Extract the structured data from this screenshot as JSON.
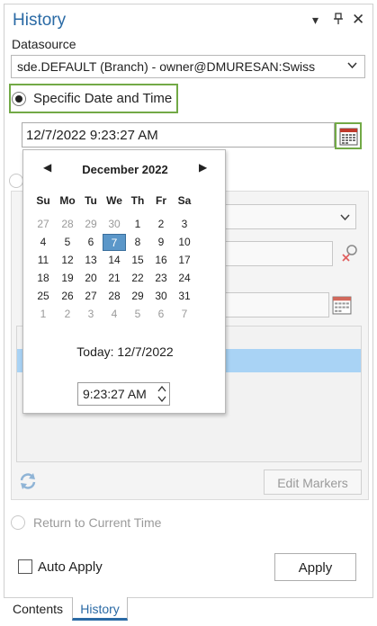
{
  "pane": {
    "title": "History",
    "datasource_label": "Datasource",
    "datasource_value": "sde.DEFAULT (Branch) - owner@DMURESAN:Swiss",
    "specific_option": "Specific Date and Time",
    "date_value": "12/7/2022 9:23:27 AM",
    "return_option": "Return to Current Time",
    "edit_markers": "Edit Markers",
    "auto_apply": "Auto Apply",
    "apply": "Apply"
  },
  "calendar": {
    "month": "December 2022",
    "weekdays": [
      "Su",
      "Mo",
      "Tu",
      "We",
      "Th",
      "Fr",
      "Sa"
    ],
    "weeks": [
      [
        "27",
        "28",
        "29",
        "30",
        "1",
        "2",
        "3"
      ],
      [
        "4",
        "5",
        "6",
        "7",
        "8",
        "9",
        "10"
      ],
      [
        "11",
        "12",
        "13",
        "14",
        "15",
        "16",
        "17"
      ],
      [
        "18",
        "19",
        "20",
        "21",
        "22",
        "23",
        "24"
      ],
      [
        "25",
        "26",
        "27",
        "28",
        "29",
        "30",
        "31"
      ],
      [
        "1",
        "2",
        "3",
        "4",
        "5",
        "6",
        "7"
      ]
    ],
    "today": "Today: 12/7/2022",
    "time": "9:23:27 AM"
  },
  "tabs": [
    {
      "label": "Contents"
    },
    {
      "label": "History"
    }
  ],
  "colors": {
    "accent": "#2a6aa5",
    "highlight_border": "#72a946",
    "selected_day": "#5b97c9",
    "selected_row": "#a9d3f5"
  }
}
